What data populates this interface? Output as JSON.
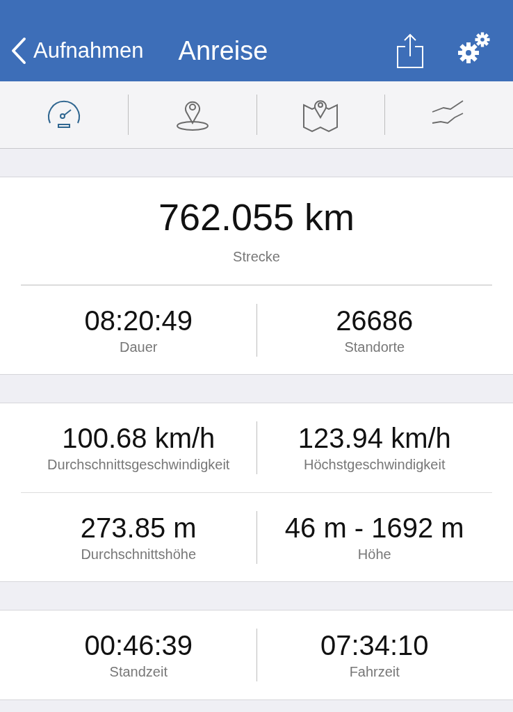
{
  "nav": {
    "back": "Aufnahmen",
    "title": "Anreise"
  },
  "tabs": [
    {
      "kind": "speedometer",
      "selected": true
    },
    {
      "kind": "pin",
      "selected": false
    },
    {
      "kind": "map",
      "selected": false
    },
    {
      "kind": "chart",
      "selected": false
    }
  ],
  "sections": [
    {
      "headline": {
        "value": "762.055 km",
        "label": "Strecke"
      },
      "rows": [
        [
          {
            "value": "08:20:49",
            "label": "Dauer"
          },
          {
            "value": "26686",
            "label": "Standorte"
          }
        ]
      ]
    },
    {
      "rows": [
        [
          {
            "value": "100.68 km/h",
            "label": "Durchschnittsgeschwindigkeit"
          },
          {
            "value": "123.94 km/h",
            "label": "Höchstgeschwindigkeit"
          }
        ],
        [
          {
            "value": "273.85 m",
            "label": "Durchschnittshöhe"
          },
          {
            "value": "46 m - 1692 m",
            "label": "Höhe"
          }
        ]
      ]
    },
    {
      "rows": [
        [
          {
            "value": "00:46:39",
            "label": "Standzeit"
          },
          {
            "value": "07:34:10",
            "label": "Fahrzeit"
          }
        ]
      ]
    }
  ]
}
